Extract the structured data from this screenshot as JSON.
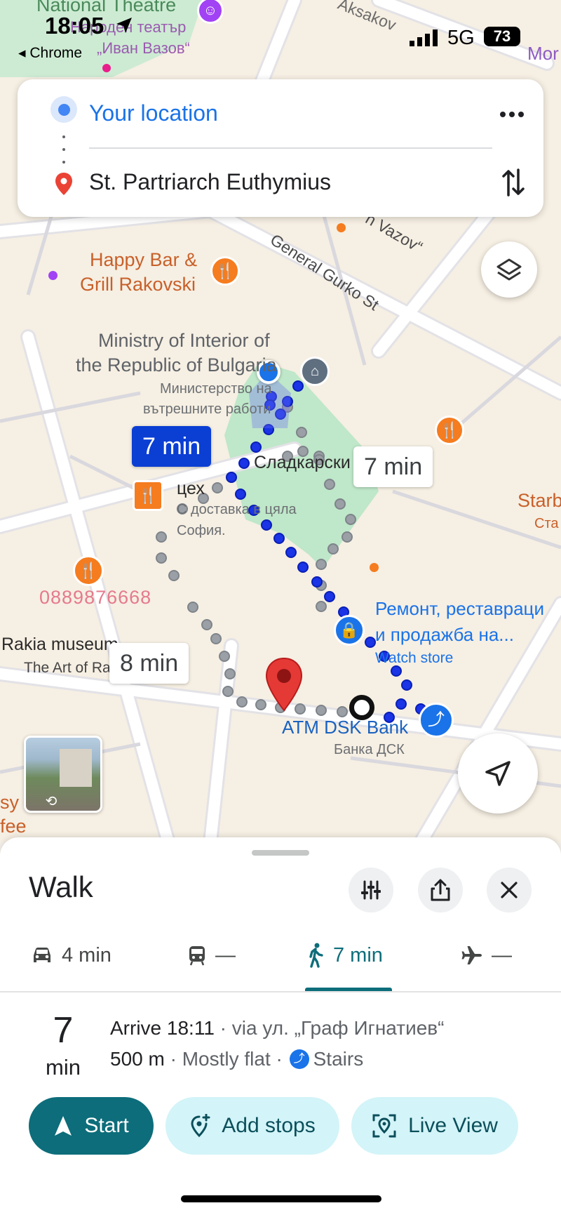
{
  "status_bar": {
    "time": "18:05",
    "back_app": "◂ Chrome",
    "network": "5G",
    "battery": "73"
  },
  "directions": {
    "origin": "Your location",
    "destination": "St. Partriarch Euthymius"
  },
  "map": {
    "labels": {
      "national_theatre": "National Theatre",
      "theatre_bg_1": "Народен театър",
      "theatre_bg_2": "„Иван Вазов“",
      "aksakov": "Aksakov",
      "moh": "Mor",
      "vazov": "n Vazov“",
      "happy_bar_1": "Happy Bar &",
      "happy_bar_2": "Grill Rakovski",
      "gurko": "General Gurko St",
      "ministry_1": "Ministry of Interior of",
      "ministry_2": "the Republic of Bulgaria",
      "ministry_bg_1": "Министерство на",
      "ministry_bg_2": "вътрешните работи",
      "sweet_1": "Сладкарски",
      "sweet_2": "цех",
      "sweet_bg_1": "С доставка в цяла",
      "sweet_bg_2": "София.",
      "starb": "Starb",
      "starb_bg": "Ста",
      "phone": "0889876668",
      "repair_1": "Ремонт, реставраци",
      "repair_2": "и продажба на...",
      "watch_store": "Watch store",
      "rakia_1": "Rakia museum",
      "rakia_2": "The Art of Ra",
      "atm_1": "ATM DSK Bank",
      "atm_2": "Банка ДСК",
      "coffee_1": "sy",
      "coffee_2": "fee"
    },
    "route_times": {
      "selected": "7 min",
      "alt_1": "7 min",
      "alt_2": "8 min"
    }
  },
  "sheet": {
    "mode_title": "Walk",
    "tabs": [
      {
        "label": "4 min",
        "icon": "car-icon"
      },
      {
        "label": "—",
        "icon": "transit-icon"
      },
      {
        "label": "7 min",
        "icon": "walk-icon",
        "active": true
      },
      {
        "label": "—",
        "icon": "flight-icon"
      }
    ],
    "summary": {
      "duration_value": "7",
      "duration_unit": "min",
      "arrive": "Arrive 18:11",
      "via": " · via ул. „Граф Игнатиев“",
      "distance": "500 m",
      "terrain": " · Mostly flat · ",
      "stairs": "Stairs"
    },
    "actions": {
      "start": "Start",
      "add_stops": "Add stops",
      "live_view": "Live View"
    }
  },
  "colors": {
    "route_blue": "#1a34e6",
    "accent_teal": "#0d6d7a",
    "pill_secondary": "#d3f4f8",
    "destination_red": "#e53935"
  }
}
